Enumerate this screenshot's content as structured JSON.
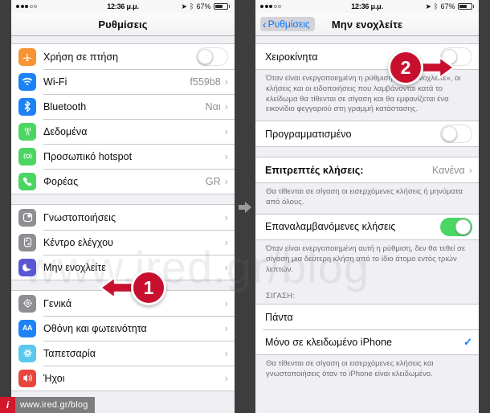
{
  "status_bar": {
    "time": "12:36 μ.μ.",
    "battery_percent": "67%",
    "location_icon": "location-arrow-icon",
    "bluetooth_icon": "bluetooth-icon"
  },
  "left_screen": {
    "nav_title": "Ρυθμίσεις",
    "groups": [
      {
        "rows": [
          {
            "label": "Χρήση σε πτήση",
            "icon": "airplane-icon",
            "color": "#f79433",
            "control": "toggle-off"
          },
          {
            "label": "Wi-Fi",
            "icon": "wifi-icon",
            "color": "#1d82f5",
            "value": "f559b8",
            "control": "chevron"
          },
          {
            "label": "Bluetooth",
            "icon": "bluetooth-icon",
            "color": "#1d82f5",
            "value": "Ναι",
            "control": "chevron"
          },
          {
            "label": "Δεδομένα",
            "icon": "cellular-icon",
            "color": "#4bd663",
            "value": "",
            "control": "chevron"
          },
          {
            "label": "Προσωπικό hotspot",
            "icon": "hotspot-icon",
            "color": "#4bd663",
            "value": "",
            "control": "chevron"
          },
          {
            "label": "Φορέας",
            "icon": "phone-icon",
            "color": "#4bd663",
            "value": "GR",
            "control": "chevron"
          }
        ]
      },
      {
        "rows": [
          {
            "label": "Γνωστοποιήσεις",
            "icon": "notifications-icon",
            "color": "#8e8e93",
            "value": "",
            "control": "chevron"
          },
          {
            "label": "Κέντρο ελέγχου",
            "icon": "control-center-icon",
            "color": "#8e8e93",
            "value": "",
            "control": "chevron"
          },
          {
            "label": "Μην ενοχλείτε",
            "icon": "moon-icon",
            "color": "#5856d6",
            "value": "",
            "control": "chevron"
          }
        ]
      },
      {
        "rows": [
          {
            "label": "Γενικά",
            "icon": "gear-icon",
            "color": "#8e8e93",
            "value": "",
            "control": "chevron"
          },
          {
            "label": "Οθόνη και φωτεινότητα",
            "icon": "display-aa-icon",
            "color": "#1d82f5",
            "value": "",
            "control": "chevron"
          },
          {
            "label": "Ταπετσαρία",
            "icon": "wallpaper-icon",
            "color": "#5ac8ef",
            "value": "",
            "control": "chevron"
          },
          {
            "label": "Ήχοι",
            "icon": "sounds-icon",
            "color": "#e8453c",
            "value": "",
            "control": "chevron"
          }
        ]
      }
    ]
  },
  "right_screen": {
    "back_label": "Ρυθμίσεις",
    "nav_title": "Μην ενοχλείτε",
    "manual_row": {
      "label": "Χειροκίνητα",
      "control": "toggle-off"
    },
    "manual_footer": "Όταν είναι ενεργοποιημένη η ρύθμιση «Μην ενοχλείτε», οι κλήσεις και οι ειδοποιήσεις που λαμβάνονται κατά το κλείδωμα θα τίθενται σε σίγαση και θα εμφανίζεται ένα εικονίδιο φεγγαριού στη γραμμή κατάστασης.",
    "scheduled_row": {
      "label": "Προγραμματισμένο",
      "control": "toggle-off"
    },
    "allowed_calls_row": {
      "label": "Επιτρεπτές κλήσεις:",
      "value": "Κανένα",
      "control": "chevron"
    },
    "allowed_calls_footer": "Θα τίθενται σε σίγαση οι εισερχόμενες κλήσεις ή μηνύματα από όλους.",
    "repeated_calls_row": {
      "label": "Επαναλαμβανόμενες κλήσεις",
      "control": "toggle-on"
    },
    "repeated_calls_footer": "Όταν είναι ενεργοποιημένη αυτή η ρύθμιση, δεν θα τεθεί σε σίγαση μια δεύτερη κλήση από το ίδιο άτομο εντός τριών λεπτών.",
    "silence_header": "ΣΙΓΑΣΗ:",
    "silence_options": [
      {
        "label": "Πάντα",
        "selected": false
      },
      {
        "label": "Μόνο σε κλειδωμένο iPhone",
        "selected": true
      }
    ],
    "silence_footer": "Θα τίθενται σε σίγαση οι εισερχόμενες κλήσεις και γνωστοποιήσεις όταν το iPhone είναι κλειδωμένο."
  },
  "callouts": [
    {
      "number": "1",
      "direction": "left"
    },
    {
      "number": "2",
      "direction": "right"
    }
  ],
  "watermarks": {
    "big": "www.ired.gr/blog",
    "bar_logo": "i",
    "bar_text": "www.ired.gr/blog"
  },
  "colors": {
    "accent_blue": "#0076ff",
    "toggle_on_green": "#4cd764",
    "badge_red": "#c8102e"
  }
}
